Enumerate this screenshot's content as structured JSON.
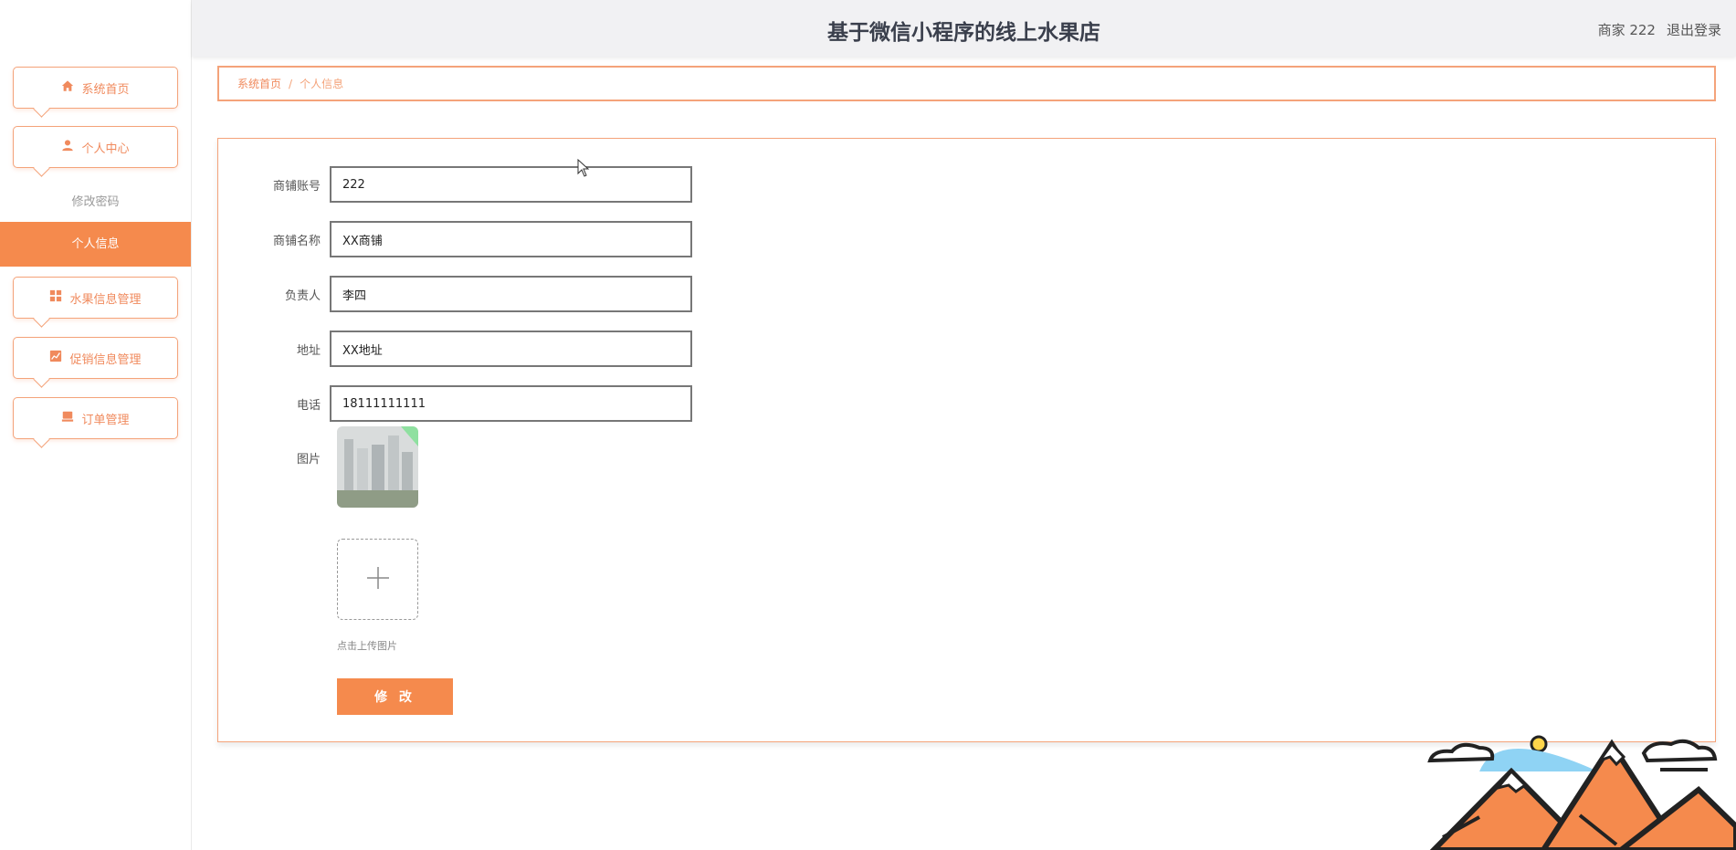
{
  "header": {
    "title": "基于微信小程序的线上水果店",
    "user": "商家 222",
    "logout": "退出登录"
  },
  "sidebar": {
    "items": [
      {
        "label": "系统首页",
        "icon": "home-icon"
      },
      {
        "label": "个人中心",
        "icon": "user-icon"
      },
      {
        "label": "水果信息管理",
        "icon": "grid-icon"
      },
      {
        "label": "促销信息管理",
        "icon": "chart-icon"
      },
      {
        "label": "订单管理",
        "icon": "order-icon"
      }
    ],
    "sub_items": [
      {
        "label": "修改密码"
      },
      {
        "label": "个人信息"
      }
    ]
  },
  "breadcrumb": {
    "home": "系统首页",
    "separator": "/",
    "current": "个人信息"
  },
  "form": {
    "fields": [
      {
        "label": "商铺账号",
        "value": "222"
      },
      {
        "label": "商铺名称",
        "value": "XX商铺"
      },
      {
        "label": "负责人",
        "value": "李四"
      },
      {
        "label": "地址",
        "value": "XX地址"
      },
      {
        "label": "电话",
        "value": "18111111111"
      }
    ],
    "image_label": "图片",
    "upload_tip": "点击上传图片",
    "submit": "修 改"
  },
  "colors": {
    "accent": "#f58a4d",
    "border": "#f4a37a",
    "header_bg": "#f1f1f3"
  }
}
